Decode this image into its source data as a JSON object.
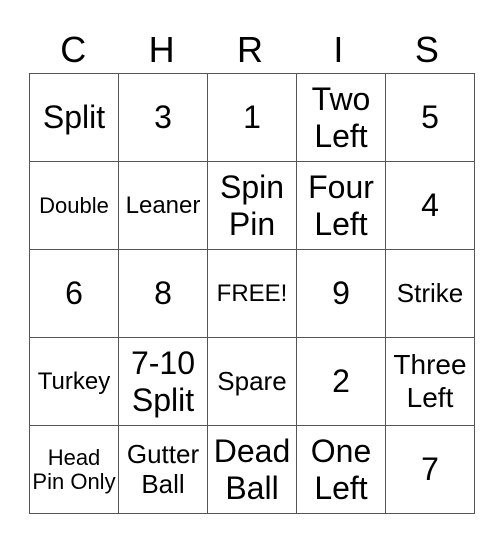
{
  "title_letters": [
    "C",
    "H",
    "R",
    "I",
    "S"
  ],
  "rows": [
    [
      {
        "text": "Split",
        "size": "s32"
      },
      {
        "text": "3",
        "size": "s32"
      },
      {
        "text": "1",
        "size": "s32"
      },
      {
        "text": "Two Left",
        "size": "s32"
      },
      {
        "text": "5",
        "size": "s32"
      }
    ],
    [
      {
        "text": "Double",
        "size": "s22"
      },
      {
        "text": "Leaner",
        "size": "s24"
      },
      {
        "text": "Spin Pin",
        "size": "s32"
      },
      {
        "text": "Four Left",
        "size": "s32"
      },
      {
        "text": "4",
        "size": "s32"
      }
    ],
    [
      {
        "text": "6",
        "size": "s32"
      },
      {
        "text": "8",
        "size": "s32"
      },
      {
        "text": "FREE!",
        "size": "s24"
      },
      {
        "text": "9",
        "size": "s32"
      },
      {
        "text": "Strike",
        "size": "s26"
      }
    ],
    [
      {
        "text": "Turkey",
        "size": "s24"
      },
      {
        "text": "7-10 Split",
        "size": "s32"
      },
      {
        "text": "Spare",
        "size": "s26"
      },
      {
        "text": "2",
        "size": "s32"
      },
      {
        "text": "Three Left",
        "size": "s28"
      }
    ],
    [
      {
        "text": "Head Pin Only",
        "size": "s20"
      },
      {
        "text": "Gutter Ball",
        "size": "s26"
      },
      {
        "text": "Dead Ball",
        "size": "s32"
      },
      {
        "text": "One Left",
        "size": "s32"
      },
      {
        "text": "7",
        "size": "s32"
      }
    ]
  ]
}
